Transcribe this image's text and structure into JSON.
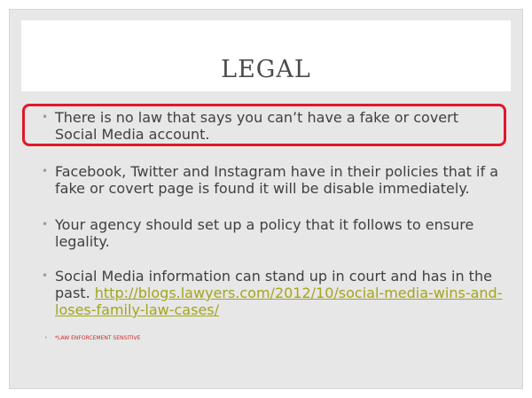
{
  "slide": {
    "title": "LEGAL",
    "bullets": [
      {
        "text": "There is no law that says you can’t have a fake or covert Social Media account."
      },
      {
        "text": "Facebook, Twitter and Instagram have in their policies that if a fake or covert page is found it will be disable immediately."
      },
      {
        "text": "Your agency should set up a policy that it follows to ensure legality."
      },
      {
        "text": " Social Media information can stand up in court and has in the past. ",
        "link": "http://blogs.lawyers.com/2012/10/social-media-wins-and-loses-family-law-cases/"
      },
      {
        "text": "*LAW ENFORCEMENT  SENSITIVE"
      }
    ],
    "bullet_glyph": "•",
    "colors": {
      "background": "#e7e7e7",
      "highlight": "#e0182b",
      "link": "#a2a51d",
      "sensitive": "#d12a2a"
    }
  }
}
